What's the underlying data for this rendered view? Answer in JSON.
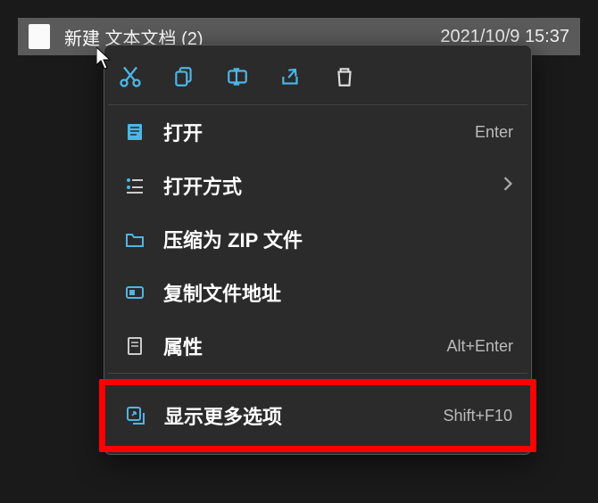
{
  "file": {
    "name": "新建 文本文档 (2)",
    "date": "2021/10/9 15:37"
  },
  "actionBar": {
    "cut": "cut",
    "copy": "copy",
    "rename": "rename",
    "share": "share",
    "delete": "delete"
  },
  "menu": {
    "open": {
      "label": "打开",
      "shortcut": "Enter"
    },
    "openWith": {
      "label": "打开方式"
    },
    "compressZip": {
      "label": "压缩为 ZIP 文件"
    },
    "copyPath": {
      "label": "复制文件地址"
    },
    "properties": {
      "label": "属性",
      "shortcut": "Alt+Enter"
    },
    "showMore": {
      "label": "显示更多选项",
      "shortcut": "Shift+F10"
    }
  }
}
